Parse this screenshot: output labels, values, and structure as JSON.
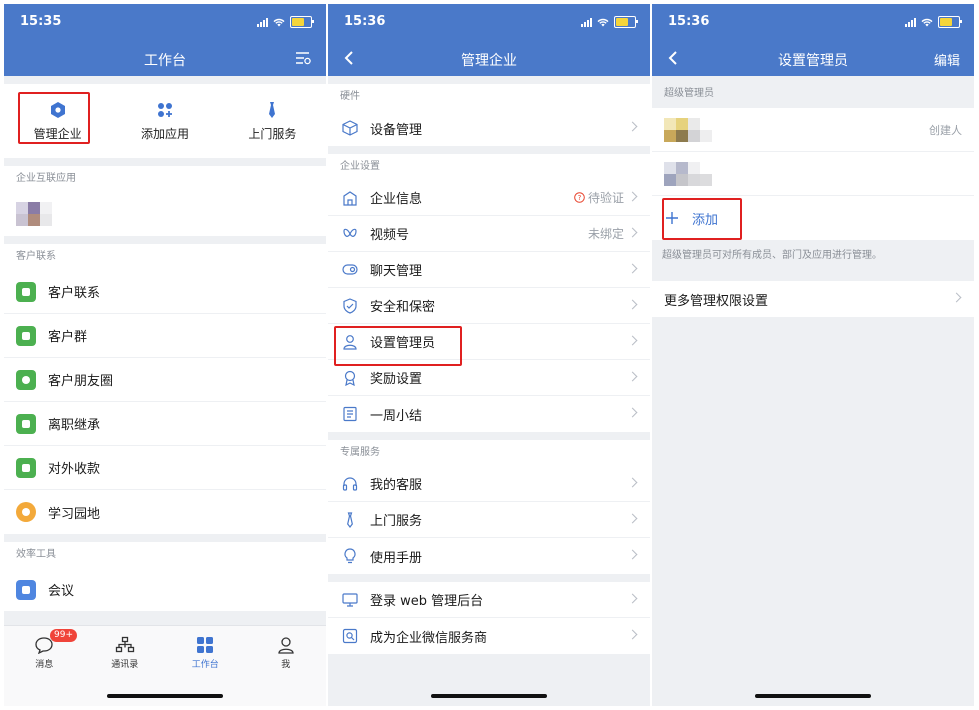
{
  "colors": {
    "brand": "#4a79c9",
    "highlight": "#e02020",
    "badge": "#f0443a",
    "accent": "#3f74d0"
  },
  "screen1": {
    "time": "15:35",
    "title": "工作台",
    "quick_actions": [
      {
        "label": "管理企业",
        "icon": "hexagon-icon"
      },
      {
        "label": "添加应用",
        "icon": "add-app-icon"
      },
      {
        "label": "上门服务",
        "icon": "tie-icon"
      }
    ],
    "section_interconnect": "企业互联应用",
    "section_customer": "客户联系",
    "customer_apps": [
      {
        "label": "客户联系",
        "color": "#4cb050",
        "icon": "chat-icon"
      },
      {
        "label": "客户群",
        "color": "#4cb050",
        "icon": "group-icon"
      },
      {
        "label": "客户朋友圈",
        "color": "#4cb050",
        "icon": "moments-icon"
      },
      {
        "label": "离职继承",
        "color": "#4cb050",
        "icon": "document-icon"
      },
      {
        "label": "对外收款",
        "color": "#4cb050",
        "icon": "payment-icon"
      },
      {
        "label": "学习园地",
        "color": "#f3a93a",
        "icon": "planet-icon"
      }
    ],
    "section_efficiency": "效率工具",
    "efficiency_apps": [
      {
        "label": "会议",
        "color": "#4f86e0",
        "icon": "cloud-icon"
      }
    ],
    "tabs": [
      {
        "label": "消息",
        "badge": "99+",
        "icon": "message-icon"
      },
      {
        "label": "通讯录",
        "icon": "contacts-icon"
      },
      {
        "label": "工作台",
        "icon": "workbench-icon"
      },
      {
        "label": "我",
        "icon": "person-icon"
      }
    ]
  },
  "screen2": {
    "time": "15:36",
    "title": "管理企业",
    "sections": [
      {
        "label": "硬件",
        "items": [
          {
            "label": "设备管理",
            "icon": "cube-icon"
          }
        ]
      },
      {
        "label": "企业设置",
        "items": [
          {
            "label": "企业信息",
            "icon": "building-icon",
            "value": "待验证",
            "warn": true
          },
          {
            "label": "视频号",
            "icon": "butterfly-icon",
            "value": "未绑定"
          },
          {
            "label": "聊天管理",
            "icon": "chat-settings-icon"
          },
          {
            "label": "安全和保密",
            "icon": "shield-check-icon"
          },
          {
            "label": "设置管理员",
            "icon": "admin-person-icon"
          },
          {
            "label": "奖励设置",
            "icon": "medal-icon"
          },
          {
            "label": "一周小结",
            "icon": "report-icon"
          }
        ]
      },
      {
        "label": "专属服务",
        "items": [
          {
            "label": "我的客服",
            "icon": "headset-icon"
          },
          {
            "label": "上门服务",
            "icon": "tie-icon"
          },
          {
            "label": "使用手册",
            "icon": "bulb-icon"
          }
        ]
      },
      {
        "label": "",
        "items": [
          {
            "label": "登录 web 管理后台",
            "icon": "monitor-icon"
          },
          {
            "label": "成为企业微信服务商",
            "icon": "search-doc-icon"
          }
        ]
      }
    ]
  },
  "screen3": {
    "time": "15:36",
    "title": "设置管理员",
    "edit": "编辑",
    "section_label": "超级管理员",
    "creator_label": "创建人",
    "add_label": "添加",
    "hint": "超级管理员可对所有成员、部门及应用进行管理。",
    "more": "更多管理权限设置"
  }
}
